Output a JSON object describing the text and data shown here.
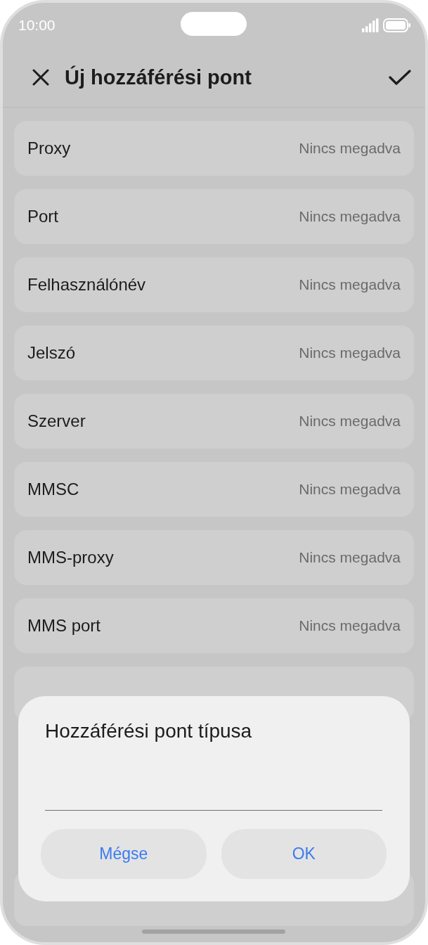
{
  "status_bar": {
    "time": "10:00"
  },
  "header": {
    "title": "Új hozzáférési pont"
  },
  "rows": [
    {
      "label": "Proxy",
      "value": "Nincs megadva"
    },
    {
      "label": "Port",
      "value": "Nincs megadva"
    },
    {
      "label": "Felhasználónév",
      "value": "Nincs megadva"
    },
    {
      "label": "Jelszó",
      "value": "Nincs megadva"
    },
    {
      "label": "Szerver",
      "value": "Nincs megadva"
    },
    {
      "label": "MMSC",
      "value": "Nincs megadva"
    },
    {
      "label": "MMS-proxy",
      "value": "Nincs megadva"
    },
    {
      "label": "MMS port",
      "value": "Nincs megadva"
    },
    {
      "kind": "covered"
    },
    {
      "kind": "covered"
    }
  ],
  "dialog": {
    "title": "Hozzáférési pont típusa",
    "buttons": [
      "Mégse",
      "OK"
    ]
  }
}
